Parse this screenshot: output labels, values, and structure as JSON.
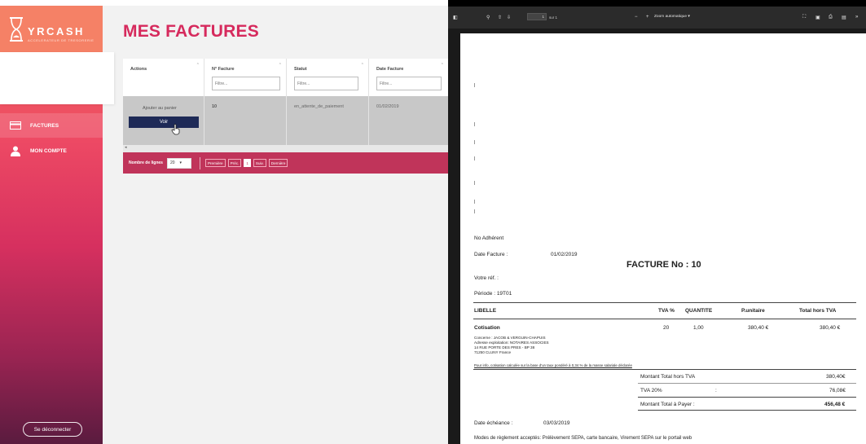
{
  "app": {
    "logo_text": "YRCASH",
    "logo_subtitle": "ACCELERATEUR DE TRESORERIE",
    "page_title": "MES FACTURES",
    "nav": [
      {
        "label": "FACTURES",
        "icon": "card-icon",
        "active": true
      },
      {
        "label": "MON COMPTE",
        "icon": "user-icon",
        "active": false
      }
    ],
    "logout_label": "Se déconnecter",
    "columns": [
      {
        "header": "Actions"
      },
      {
        "header": "N° Facture",
        "placeholder": "Filtre..."
      },
      {
        "header": "Statut",
        "placeholder": "Filtre..."
      },
      {
        "header": "Date Facture",
        "placeholder": "Filtre..."
      }
    ],
    "row": {
      "add_to_cart": "Ajouter au panier",
      "view_button": "Voir",
      "invoice_no": "10",
      "status": "en_attente_de_paiement",
      "date": "01/02/2019"
    },
    "pager": {
      "rows_label": "Nombre de lignes",
      "rows_value": "20",
      "first": "Première",
      "prev": "Préc.",
      "current": "1",
      "next": "Suiv.",
      "last": "Dernière"
    }
  },
  "viewer": {
    "page_input": "1",
    "page_count": "sur 1",
    "zoom": "Zoom automatique"
  },
  "invoice": {
    "member_no": "No Adhérent",
    "date_label": "Date Facture :",
    "date_value": "01/02/2019",
    "title": "FACTURE No : 10",
    "ref_label": "Votre réf. :",
    "period_label": "Période : 19T01",
    "headers": {
      "label": "LIBELLE",
      "vat": "TVA %",
      "qty": "QUANTITE",
      "unit": "P.unitaire",
      "total": "Total hors TVA"
    },
    "line": {
      "label": "Cotisation",
      "vat": "20",
      "qty": "1,00",
      "unit": "380,40 €",
      "total": "380,40 €",
      "details": [
        "Concerne : JACOB & VERGUIN-CHAPUIS",
        "Adresse exploitation: NOTAIRES ASSOCIES",
        "14 RUE PORTE DES PRES - BP 38",
        "71250 CLUNY France",
        "Pour info, cotisation calculée sur la base d'un taux pondéré à 0,34 % de la masse salariale déclarée"
      ]
    },
    "totals": [
      {
        "label": "Montant Total hors TVA",
        "value": "380,40€"
      },
      {
        "label": "TVA 20%",
        "value": "76,08€"
      },
      {
        "label": "Montant Total à Payer :",
        "value": "456,48 €"
      }
    ],
    "due_label": "Date échéance :",
    "due_value": "03/03/2019",
    "payment_modes": "Modes de règlement acceptés: Prélèvement SEPA, carte bancaire, Virement SEPA sur le portail web"
  }
}
